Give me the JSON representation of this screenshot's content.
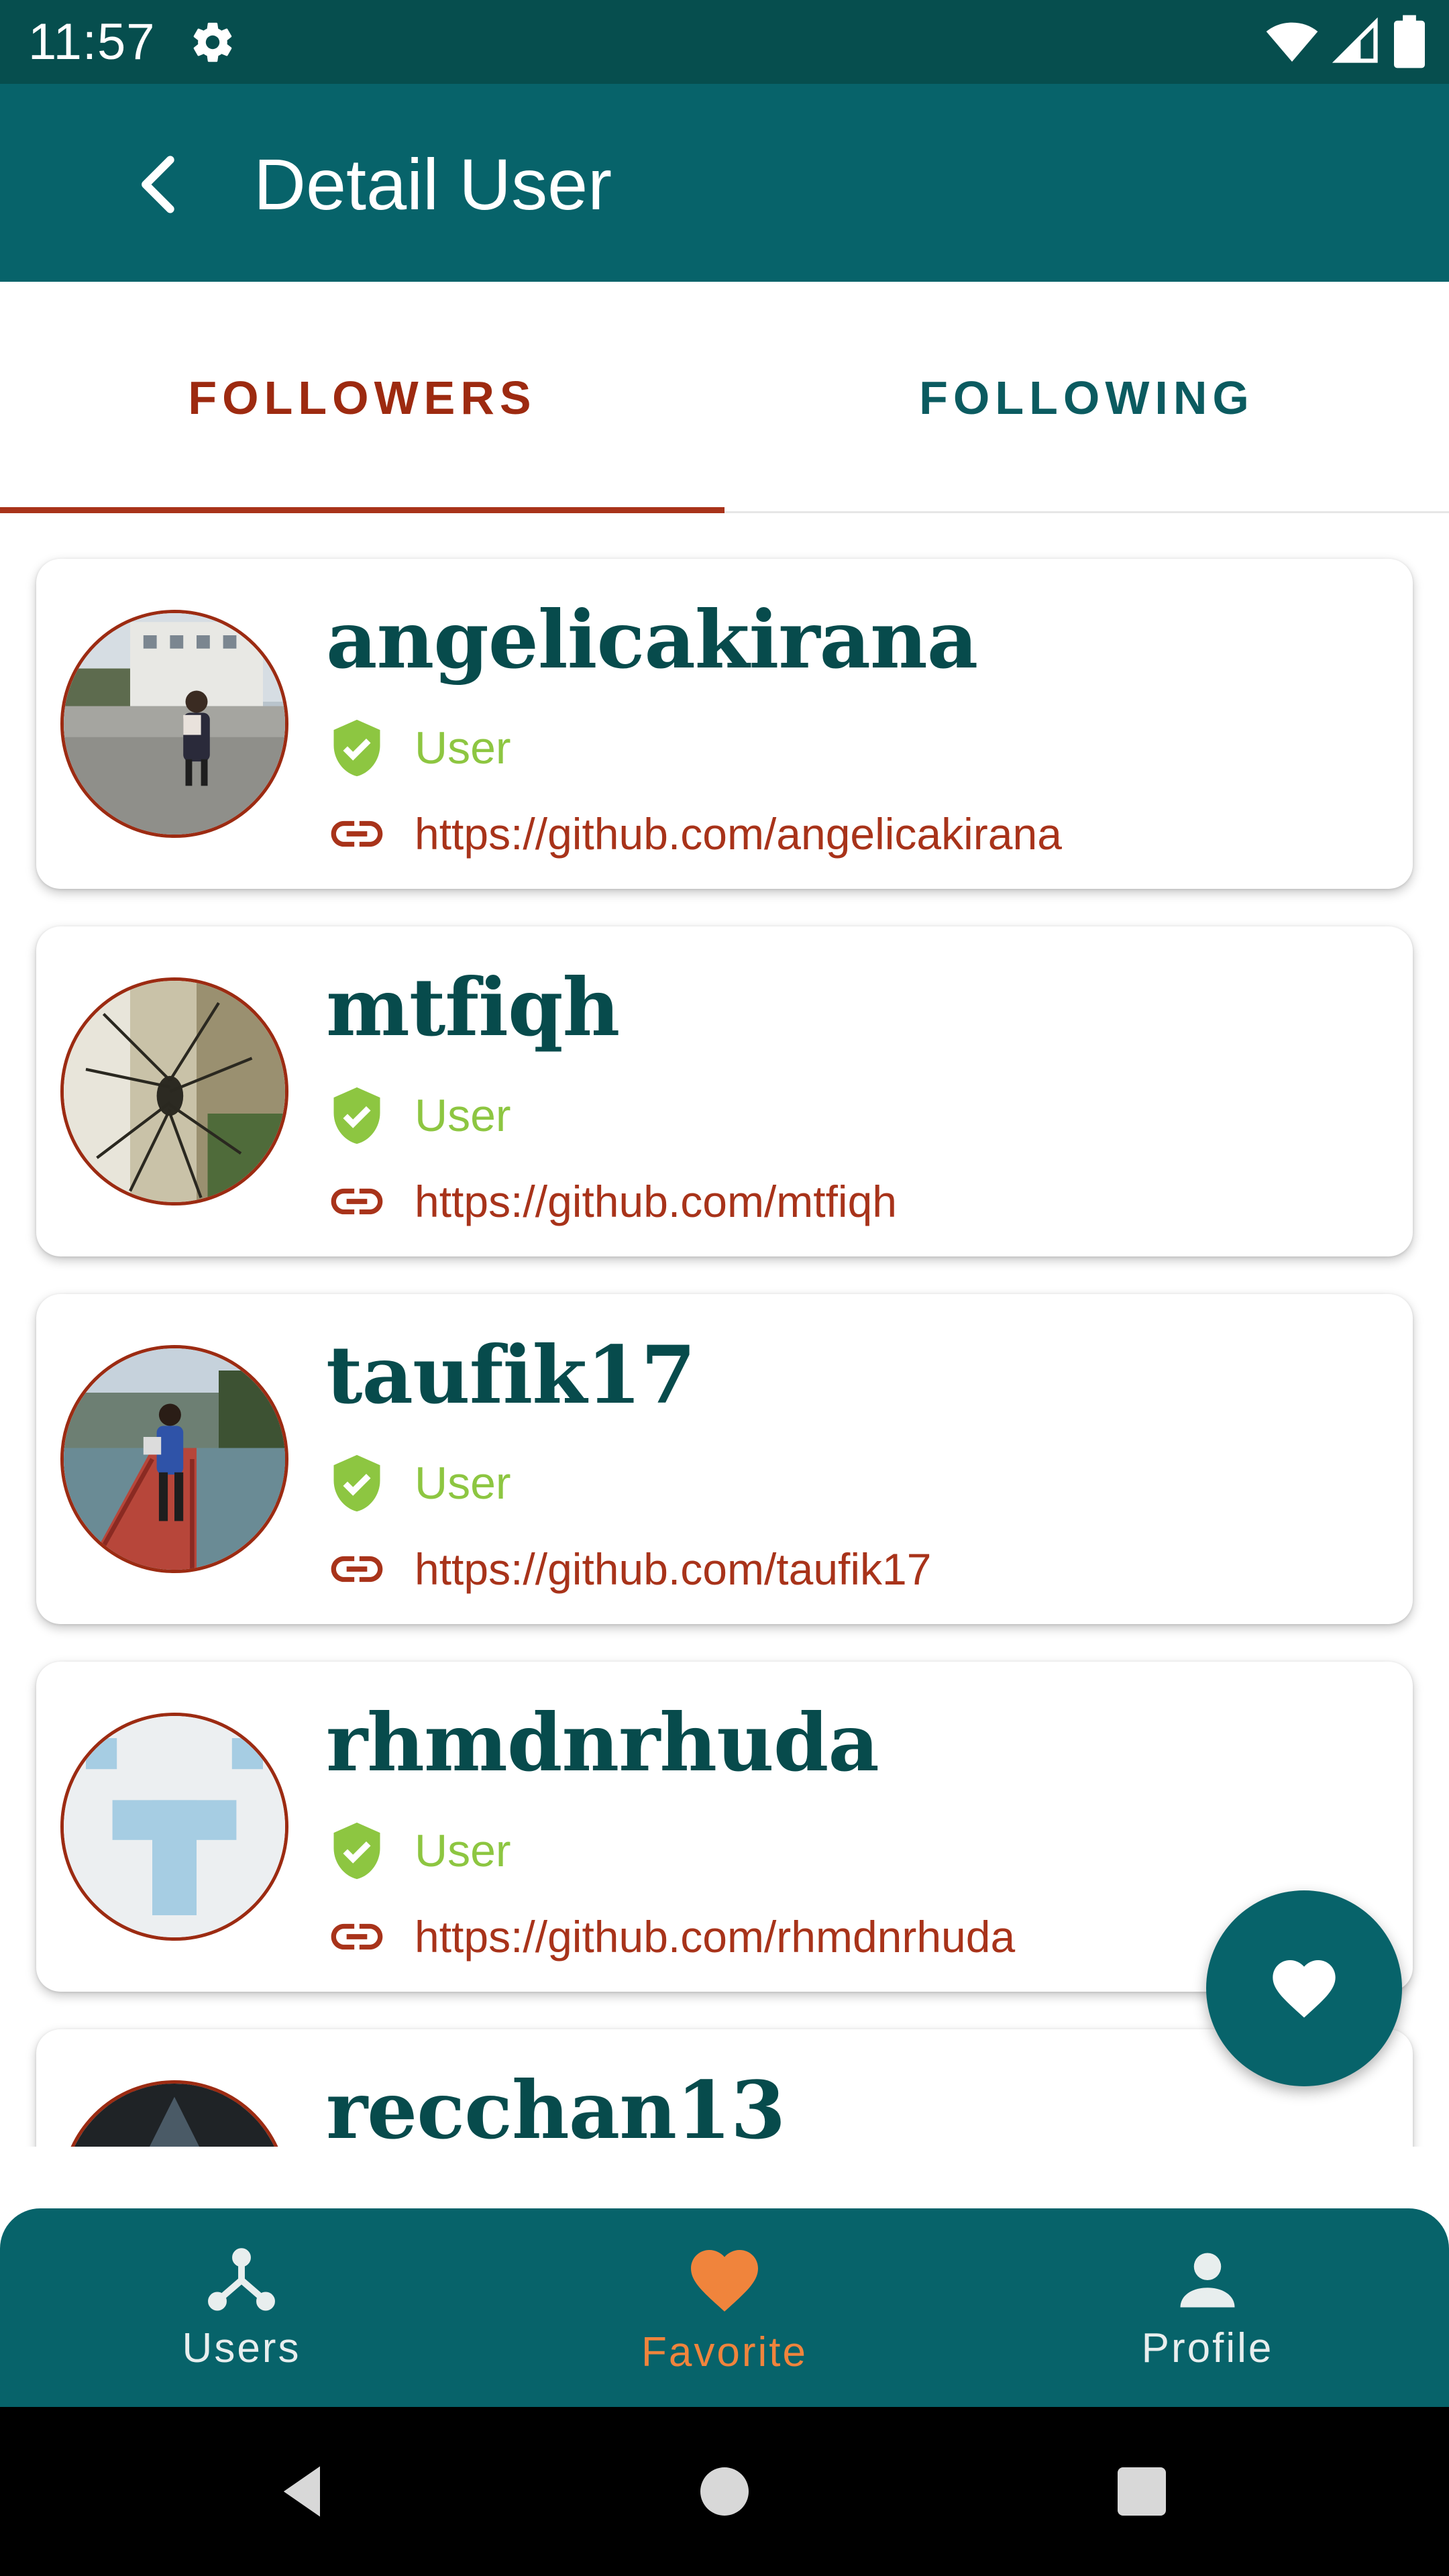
{
  "status_bar": {
    "time": "11:57"
  },
  "app_bar": {
    "title": "Detail User"
  },
  "tabs": [
    {
      "label": "FOLLOWERS",
      "selected": true
    },
    {
      "label": "FOLLOWING",
      "selected": false
    }
  ],
  "followers": [
    {
      "username": "angelicakirana",
      "role": "User",
      "url": "https://github.com/angelicakirana"
    },
    {
      "username": "mtfiqh",
      "role": "User",
      "url": "https://github.com/mtfiqh"
    },
    {
      "username": "taufik17",
      "role": "User",
      "url": "https://github.com/taufik17"
    },
    {
      "username": "rhmdnrhuda",
      "role": "User",
      "url": "https://github.com/rhmdnrhuda"
    },
    {
      "username": "recchan13"
    }
  ],
  "bottom_nav": [
    {
      "label": "Users",
      "icon": "hub-icon",
      "selected": false
    },
    {
      "label": "Favorite",
      "icon": "heart-icon",
      "selected": true
    },
    {
      "label": "Profile",
      "icon": "person-icon",
      "selected": false
    }
  ],
  "colors": {
    "primary": "#07636a",
    "status_bar": "#064e4e",
    "accent": "#a8331a",
    "role_green": "#8dc641",
    "favorite_orange": "#f0843c"
  },
  "fab": {
    "icon": "heart-icon"
  }
}
